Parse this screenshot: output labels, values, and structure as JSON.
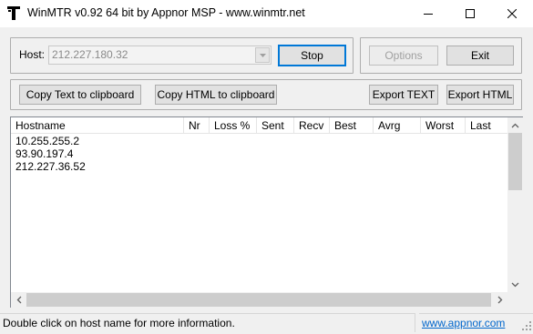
{
  "window": {
    "title": "WinMTR v0.92 64 bit by Appnor MSP - www.winmtr.net"
  },
  "host": {
    "label": "Host:",
    "value": "212.227.180.32"
  },
  "buttons": {
    "stop": "Stop",
    "options": "Options",
    "exit": "Exit",
    "copy_text": "Copy Text to clipboard",
    "copy_html": "Copy HTML to clipboard",
    "export_text": "Export TEXT",
    "export_html": "Export HTML"
  },
  "table": {
    "columns": [
      "Hostname",
      "Nr",
      "Loss %",
      "Sent",
      "Recv",
      "Best",
      "Avrg",
      "Worst",
      "Last"
    ],
    "rows": [
      {
        "hostname": "10.255.255.2"
      },
      {
        "hostname": "93.90.197.4"
      },
      {
        "hostname": "212.227.36.52"
      }
    ]
  },
  "status": {
    "message": "Double click on host name for more information.",
    "link": "www.appnor.com"
  }
}
